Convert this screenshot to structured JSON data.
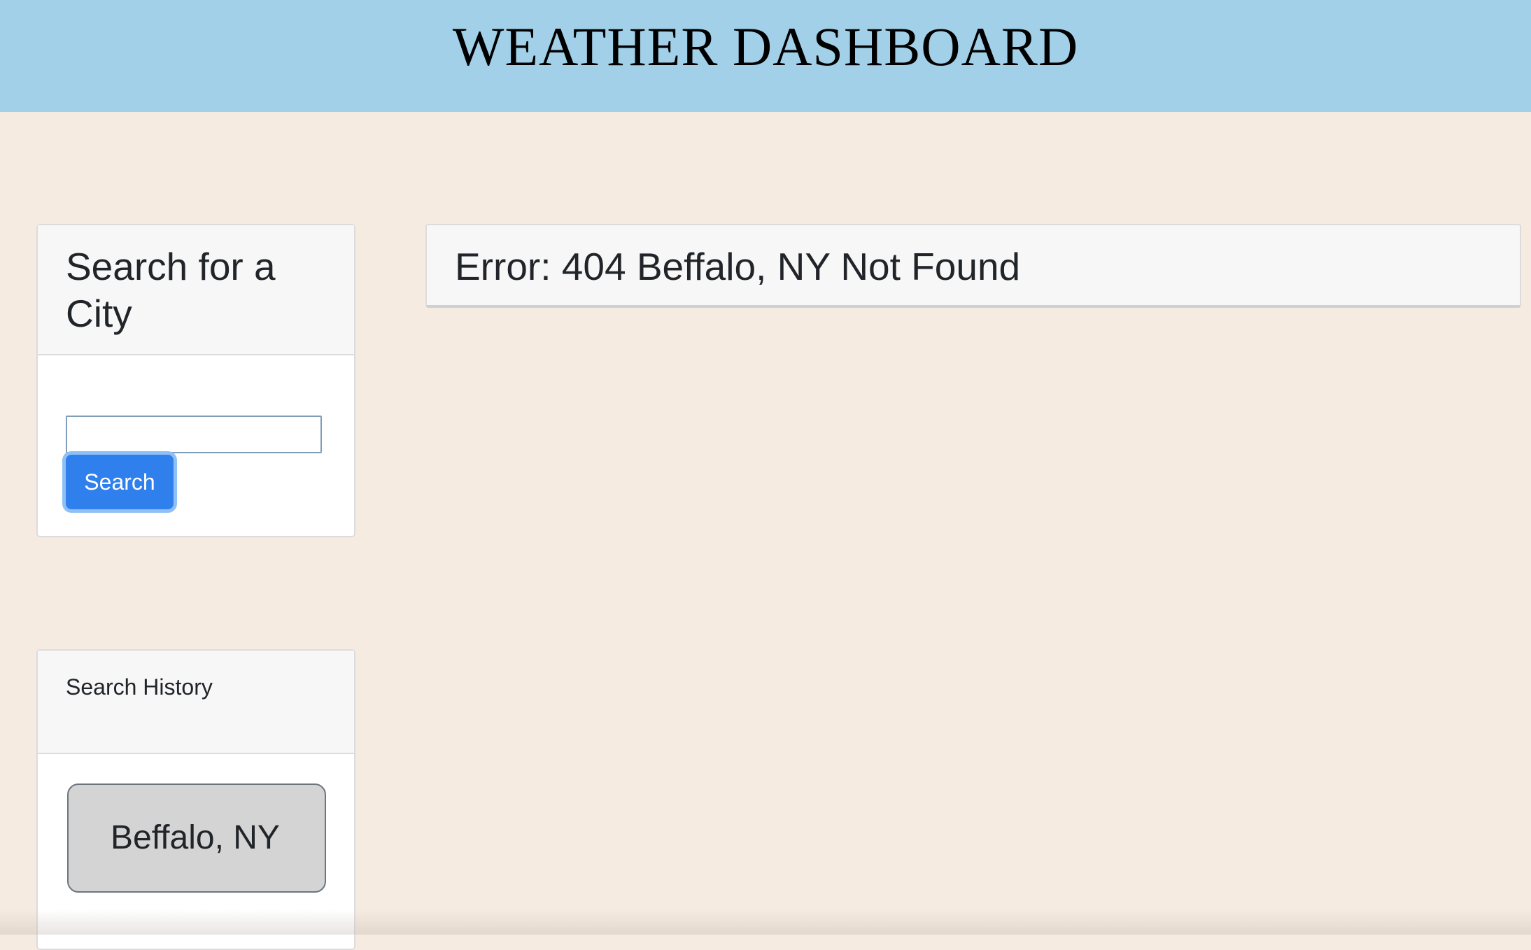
{
  "header": {
    "title": "WEATHER DASHBOARD"
  },
  "search_card": {
    "title": "Search for a City",
    "input_value": "",
    "input_placeholder": "",
    "button_label": "Search"
  },
  "history_card": {
    "title": "Search History",
    "items": [
      {
        "label": "Beffalo, NY"
      }
    ]
  },
  "error_card": {
    "message": "Error: 404 Beffalo, NY Not Found"
  },
  "colors": {
    "header_bg": "#a2d0e8",
    "page_bg": "#f5ebe0",
    "button_bg": "#2f80ed",
    "history_item_bg": "#d4d4d4"
  }
}
